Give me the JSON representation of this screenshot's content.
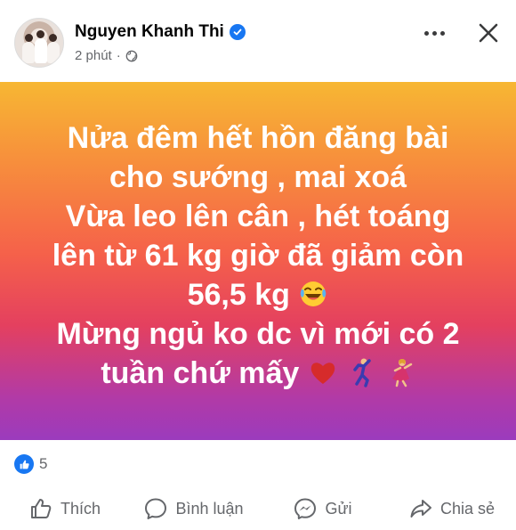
{
  "post": {
    "author": "Nguyen Khanh Thi",
    "timestamp": "2 phút",
    "separator": "·",
    "audience_icon": "globe-icon",
    "verified_icon": "verified-badge-icon",
    "text_lines": [
      "Nửa đêm hết hồn đăng bài",
      "cho sướng , mai xoá",
      "Vừa leo lên cân , hét toáng",
      "lên từ 61 kg giờ đã giảm còn",
      "56,5 kg",
      "Mừng ngủ ko dc vì mới có 2",
      "tuần chứ mấy"
    ],
    "emojis": [
      "laughing-tears-emoji",
      "red-heart-emoji",
      "man-dancing-emoji",
      "woman-dancing-emoji"
    ],
    "background_colors": [
      "#f7b733",
      "#f5614a",
      "#9b3bbd"
    ]
  },
  "reactions": {
    "icon": "like-icon",
    "count": "5"
  },
  "actions": [
    {
      "label": "Thích",
      "icon": "thumbs-up-icon"
    },
    {
      "label": "Bình luận",
      "icon": "comment-icon"
    },
    {
      "label": "Gửi",
      "icon": "messenger-icon"
    },
    {
      "label": "Chia sẻ",
      "icon": "share-icon"
    }
  ],
  "colors": {
    "accent": "#1877f2",
    "secondary_text": "#65676b"
  }
}
